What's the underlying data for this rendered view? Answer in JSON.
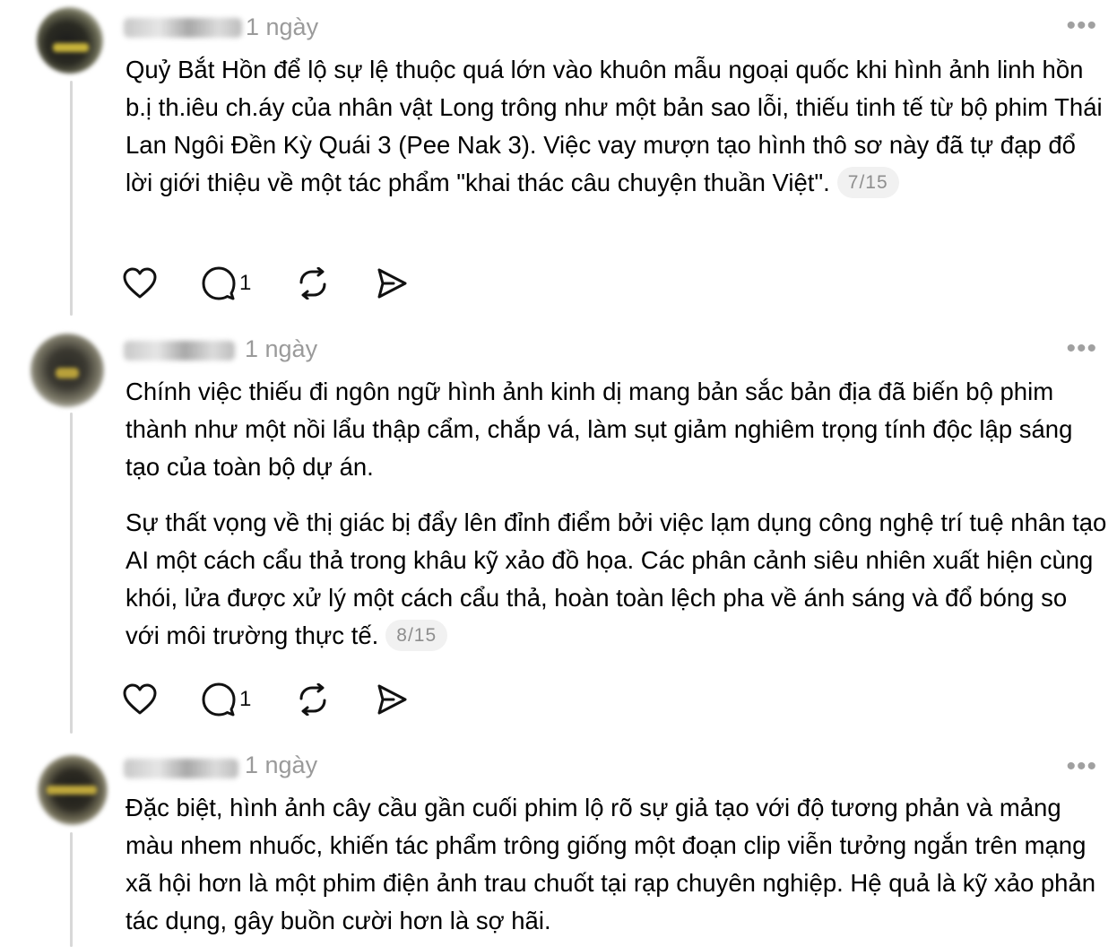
{
  "posts": [
    {
      "time": "1 ngày",
      "more_label": "•••",
      "paragraphs": [
        "Quỷ Bắt Hồn để lộ sự lệ thuộc quá lớn vào khuôn mẫu ngoại quốc khi hình ảnh linh hồn b.ị th.iêu ch.áy của nhân vật Long trông như một bản sao lỗi, thiếu tinh tế từ bộ phim Thái Lan Ngôi Đền Kỳ Quái 3 (Pee Nak 3). Việc vay mượn tạo hình thô sơ này đã tự đạp đổ lời giới thiệu về một tác phẩm \"khai thác câu chuyện thuần Việt\"."
      ],
      "counter": "7/15",
      "reply_count": "1"
    },
    {
      "time": "1 ngày",
      "more_label": "•••",
      "paragraphs": [
        "Chính việc thiếu đi ngôn ngữ hình ảnh kinh dị mang bản sắc bản địa đã biến bộ phim thành như một nồi lẩu thập cẩm, chắp vá, làm sụt giảm nghiêm trọng tính độc lập sáng tạo của toàn bộ dự án.",
        "Sự thất vọng về thị giác bị đẩy lên đỉnh điểm bởi việc lạm dụng công nghệ trí tuệ nhân tạo AI một cách cẩu thả trong khâu kỹ xảo đồ họa. Các phân cảnh siêu nhiên xuất hiện cùng khói, lửa được xử lý một cách cẩu thả, hoàn toàn lệch pha về ánh sáng và đổ bóng so với môi trường thực tế."
      ],
      "counter": "8/15",
      "reply_count": "1"
    },
    {
      "time": "1 ngày",
      "more_label": "•••",
      "paragraphs": [
        "Đặc biệt, hình ảnh cây cầu gần cuối phim lộ rõ sự giả tạo với độ tương phản và mảng màu nhem nhuốc, khiến tác phẩm trông giống một đoạn clip viễn tưởng ngắn trên mạng xã hội hơn là một phim điện ảnh trau chuốt tại rạp chuyên nghiệp. Hệ quả là kỹ xảo phản tác dụng, gây buồn cười hơn là sợ hãi."
      ]
    }
  ],
  "icons": {
    "like": "heart-icon",
    "reply": "comment-icon",
    "repost": "repost-icon",
    "share": "send-icon",
    "more": "more-icon"
  },
  "colors": {
    "text": "#000000",
    "muted": "#9a9a9a",
    "thread_line": "#d8d8d8",
    "counter_bg": "#f1f1f1"
  }
}
